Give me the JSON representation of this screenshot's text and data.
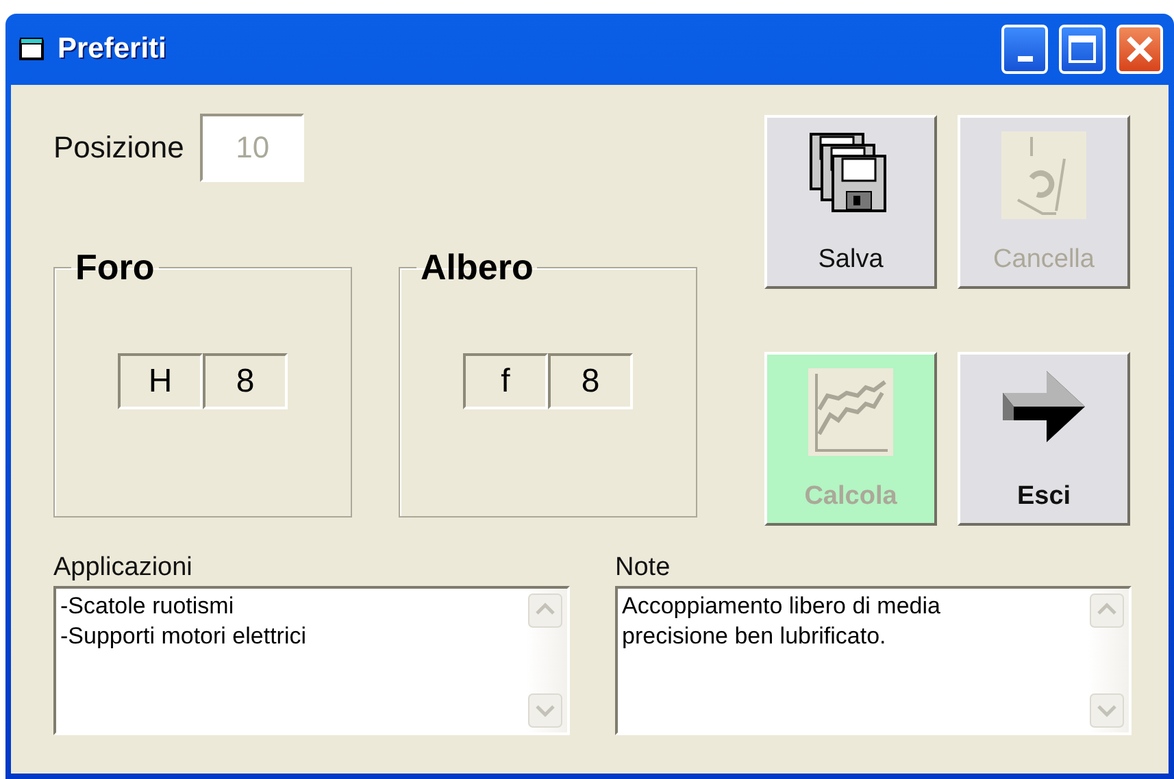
{
  "window": {
    "title": "Preferiti"
  },
  "position": {
    "label": "Posizione",
    "value": "10",
    "disabled": true
  },
  "groups": [
    {
      "title": "Foro",
      "cells": [
        "H",
        "8"
      ]
    },
    {
      "title": "Albero",
      "cells": [
        "f",
        "8"
      ]
    }
  ],
  "buttons": [
    {
      "label": "Salva",
      "kind": "save",
      "disabled": false,
      "bold": false,
      "highlighted": false
    },
    {
      "label": "Cancella",
      "kind": "delete",
      "disabled": true,
      "bold": false,
      "highlighted": false
    },
    {
      "label": "Calcola",
      "kind": "chart",
      "disabled": true,
      "bold": true,
      "highlighted": true
    },
    {
      "label": "Esci",
      "kind": "exit",
      "disabled": false,
      "bold": true,
      "highlighted": false
    }
  ],
  "fields": [
    {
      "label": "Applicazioni",
      "lines": [
        "-Scatole ruotismi",
        "-Supporti motori elettrici"
      ]
    },
    {
      "label": "Note",
      "lines": [
        "Accoppiamento libero di media",
        "precisione ben lubrificato."
      ]
    }
  ]
}
